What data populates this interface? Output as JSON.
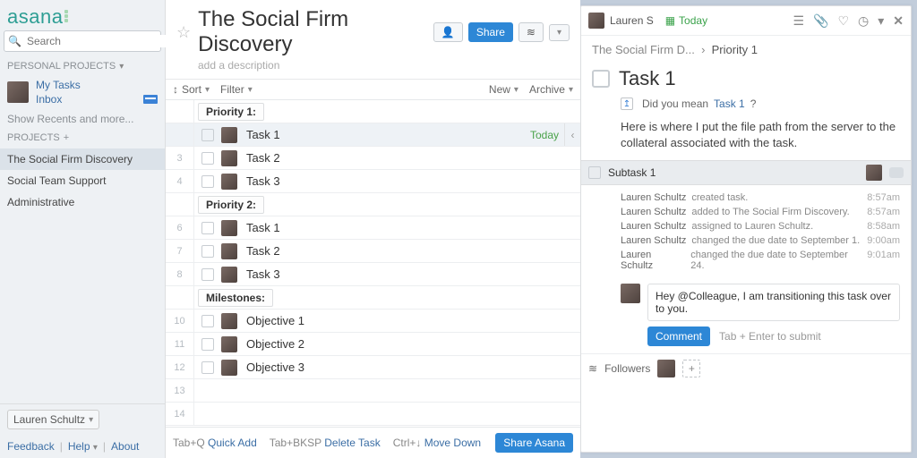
{
  "brand": "asana",
  "search": {
    "placeholder": "Search"
  },
  "sidebar": {
    "personal_header": "Personal Projects",
    "my_tasks": "My Tasks",
    "inbox": "Inbox",
    "show_recents": "Show Recents and more...",
    "projects_header": "Projects",
    "projects": [
      "The Social Firm Discovery",
      "Social Team Support",
      "Administrative"
    ],
    "active_project_index": 0,
    "current_user": "Lauren Schultz",
    "footer": {
      "feedback": "Feedback",
      "help": "Help",
      "about": "About"
    }
  },
  "project": {
    "title": "The Social Firm Discovery",
    "description_placeholder": "add a description",
    "share": "Share",
    "toolbar": {
      "sort": "Sort",
      "filter": "Filter",
      "new": "New",
      "archive": "Archive"
    },
    "sections": [
      {
        "label": "Priority 1:",
        "start_num": null,
        "tasks": [
          {
            "num": "",
            "name": "Task 1",
            "due": "Today",
            "selected": true
          },
          {
            "num": "3",
            "name": "Task 2"
          },
          {
            "num": "4",
            "name": "Task 3"
          }
        ]
      },
      {
        "label": "Priority 2:",
        "tasks": [
          {
            "num": "6",
            "name": "Task 1"
          },
          {
            "num": "7",
            "name": "Task 2"
          },
          {
            "num": "8",
            "name": "Task 3"
          }
        ]
      },
      {
        "label": "Milestones:",
        "tasks": [
          {
            "num": "10",
            "name": "Objective 1"
          },
          {
            "num": "11",
            "name": "Objective 2"
          },
          {
            "num": "12",
            "name": "Objective 3"
          }
        ]
      }
    ],
    "empty_row_nums": [
      "13",
      "14"
    ]
  },
  "shortcuts": {
    "quick_add_key": "Tab+Q",
    "quick_add": "Quick Add",
    "delete_key": "Tab+BKSP",
    "delete": "Delete Task",
    "move_key": "Ctrl+↓",
    "move": "Move Down",
    "share_asana": "Share Asana"
  },
  "detail": {
    "assignee_short": "Lauren S",
    "due_label": "Today",
    "breadcrumb_project": "The Social Firm D...",
    "breadcrumb_section": "Priority 1",
    "title": "Task 1",
    "did_you_mean_prefix": "Did you mean",
    "did_you_mean_link": "Task 1",
    "description": "Here is where I put the file path from the server to the collateral associated with the task.",
    "subtask": "Subtask 1",
    "activity": [
      {
        "who": "Lauren Schultz",
        "what": "created task.",
        "time": "8:57am"
      },
      {
        "who": "Lauren Schultz",
        "what": "added to The Social Firm Discovery.",
        "time": "8:57am"
      },
      {
        "who": "Lauren Schultz",
        "what": "assigned to Lauren Schultz.",
        "time": "8:58am"
      },
      {
        "who": "Lauren Schultz",
        "what": "changed the due date to September 1.",
        "time": "9:00am"
      },
      {
        "who": "Lauren Schultz",
        "what": "changed the due date to September 24.",
        "time": "9:01am"
      }
    ],
    "comment_draft": "Hey @Colleague, I am transitioning this task over to you.",
    "comment_btn": "Comment",
    "comment_hint": "Tab + Enter to submit",
    "followers_label": "Followers"
  }
}
